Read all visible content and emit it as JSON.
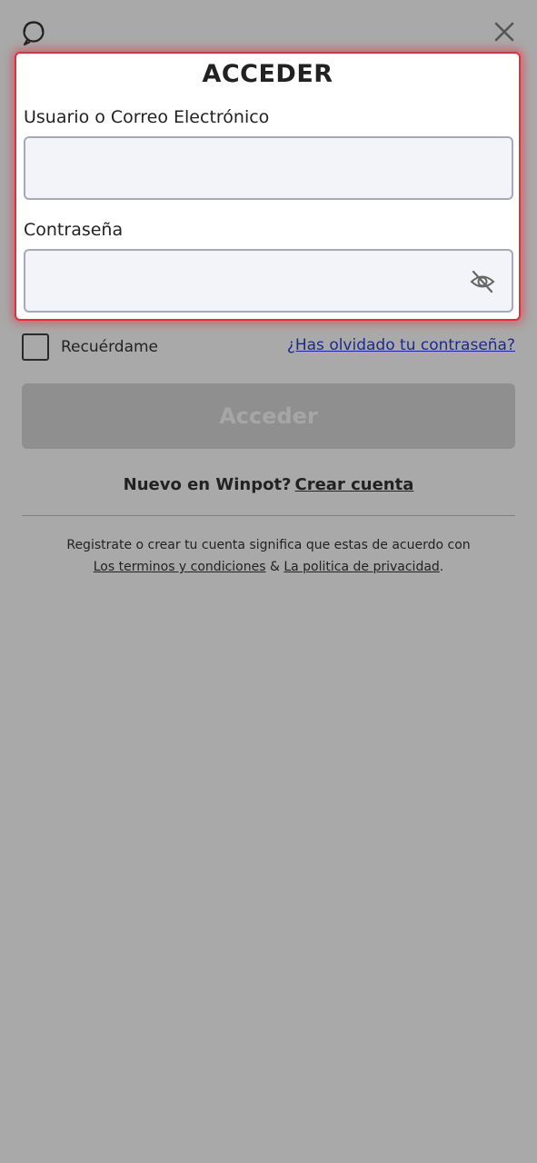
{
  "header": {
    "support_icon": "headset-chat-icon",
    "close_icon": "close-icon"
  },
  "login": {
    "title": "ACCEDER",
    "username_label": "Usuario o Correo Electrónico",
    "username_value": "",
    "password_label": "Contraseña",
    "password_value": "",
    "password_toggle_icon": "eye-off-icon",
    "accent_color": "#e0303a"
  },
  "options": {
    "remember_label": "Recuérdame",
    "remember_checked": false,
    "forgot_link": "¿Has olvidado tu contraseña?"
  },
  "submit": {
    "label": "Acceder"
  },
  "signup": {
    "prompt": "Nuevo en Winpot?",
    "link": "Crear cuenta"
  },
  "legal": {
    "text": "Registrate o crear tu cuenta significa que estas de acuerdo con",
    "terms_link": "Los terminos y condiciones",
    "separator": "&",
    "privacy_link": "La politica de privacidad",
    "end": "."
  }
}
